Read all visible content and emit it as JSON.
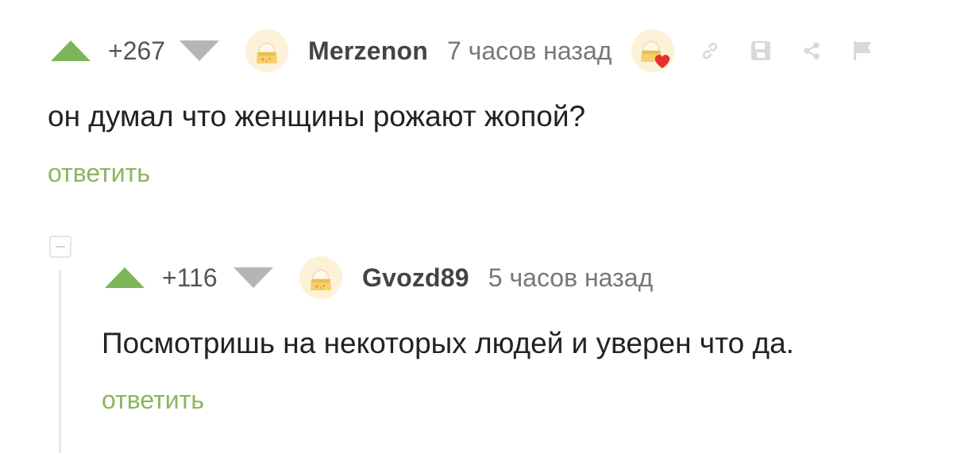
{
  "colors": {
    "upvote": "#7db559",
    "downvote": "#b5b5b5",
    "reply_link": "#8ab65c",
    "username": "#444444",
    "timestamp": "#777777",
    "heart": "#e8312f"
  },
  "comments": [
    {
      "rating": "+267",
      "username": "Merzenon",
      "timestamp": "7 часов назад",
      "text": "он думал что женщины рожают жопой?",
      "reply_label": "ответить",
      "avatar_icon": "default-cheese-avatar-icon",
      "has_badge": true,
      "actions": [
        "link-icon",
        "save-icon",
        "share-icon",
        "flag-icon"
      ]
    },
    {
      "rating": "+116",
      "username": "Gvozd89",
      "timestamp": "5 часов назад",
      "text": "Посмотришь на некоторых людей и уверен что да.",
      "reply_label": "ответить",
      "avatar_icon": "default-cheese-avatar-icon",
      "has_badge": false
    }
  ]
}
